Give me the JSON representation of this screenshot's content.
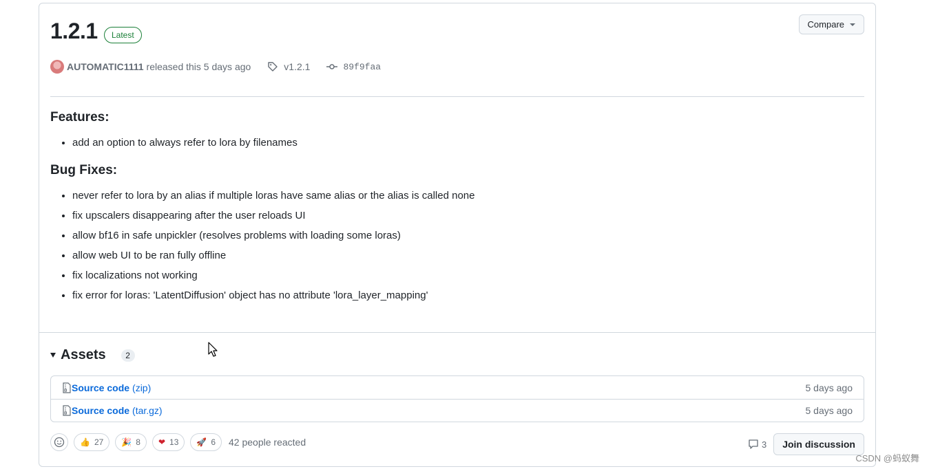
{
  "release": {
    "title": "1.2.1",
    "badge": "Latest",
    "compare_label": "Compare",
    "author": "AUTOMATIC1111",
    "released_text": "released this 5 days ago",
    "tag": "v1.2.1",
    "commit": "89f9faa"
  },
  "notes": {
    "features_heading": "Features:",
    "features": [
      "add an option to always refer to lora by filenames"
    ],
    "bugfixes_heading": "Bug Fixes:",
    "bugfixes": [
      "never refer to lora by an alias if multiple loras have same alias or the alias is called none",
      "fix upscalers disappearing after the user reloads UI",
      "allow bf16 in safe unpickler (resolves problems with loading some loras)",
      "allow web UI to be ran fully offline",
      "fix localizations not working",
      "fix error for loras: 'LatentDiffusion' object has no attribute 'lora_layer_mapping'"
    ]
  },
  "assets": {
    "heading": "Assets",
    "count": "2",
    "items": [
      {
        "name": "Source code",
        "ext": "(zip)",
        "date": "5 days ago"
      },
      {
        "name": "Source code",
        "ext": "(tar.gz)",
        "date": "5 days ago"
      }
    ]
  },
  "reactions": {
    "items": [
      {
        "icon": "thumbs-up-icon",
        "count": "27"
      },
      {
        "icon": "party-popper-icon",
        "count": "8"
      },
      {
        "icon": "heart-icon",
        "count": "13"
      },
      {
        "icon": "rocket-icon",
        "count": "6"
      }
    ],
    "summary": "42 people reacted"
  },
  "discussion": {
    "comment_count": "3",
    "join_label": "Join discussion"
  },
  "watermark": "CSDN @蚂蚁舞",
  "colors": {
    "accent_green": "#1a7f37",
    "link_blue": "#0969da",
    "border": "#d0d7de",
    "muted": "#656d76"
  }
}
